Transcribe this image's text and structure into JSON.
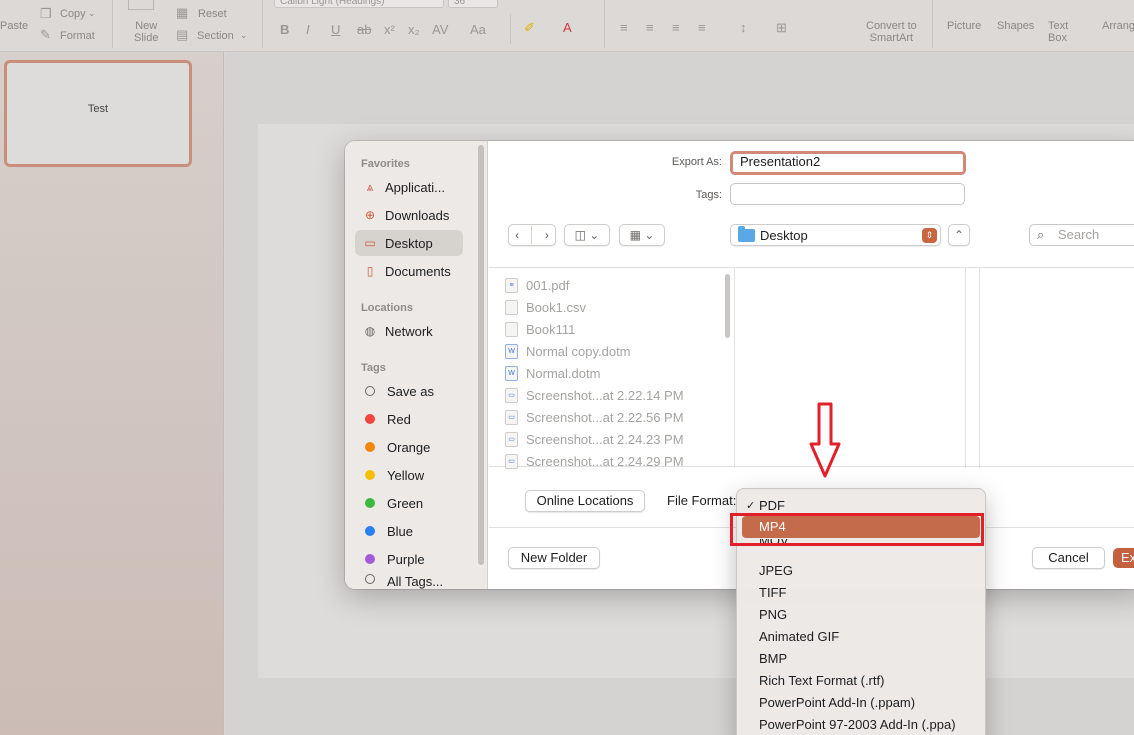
{
  "ribbon": {
    "paste": "Paste",
    "copy": "Copy",
    "format": "Format",
    "new_slide": "New\nSlide",
    "reset": "Reset",
    "section": "Section",
    "font_name": "Calibri Light (Headings)",
    "font_size": "36",
    "convert_smartart": "Convert to\nSmartArt",
    "picture": "Picture",
    "shapes": "Shapes",
    "text_box": "Text\nBox",
    "arrange": "Arrang"
  },
  "thumbnail": {
    "text": "Test"
  },
  "dialog": {
    "sidebar": {
      "favorites_head": "Favorites",
      "favorites": [
        {
          "label": "Applicati...",
          "icon": "applications-icon"
        },
        {
          "label": "Downloads",
          "icon": "downloads-icon"
        },
        {
          "label": "Desktop",
          "icon": "desktop-icon",
          "selected": true
        },
        {
          "label": "Documents",
          "icon": "documents-icon"
        }
      ],
      "locations_head": "Locations",
      "locations": [
        {
          "label": "Network",
          "icon": "network-icon"
        }
      ],
      "tags_head": "Tags",
      "tags": [
        {
          "label": "Save as",
          "color": ""
        },
        {
          "label": "Red",
          "color": "#f2453d"
        },
        {
          "label": "Orange",
          "color": "#f3860d"
        },
        {
          "label": "Yellow",
          "color": "#f5c000"
        },
        {
          "label": "Green",
          "color": "#3cb93c"
        },
        {
          "label": "Blue",
          "color": "#2a7ff0"
        },
        {
          "label": "Purple",
          "color": "#a45ad6"
        },
        {
          "label": "All Tags...",
          "color": ""
        }
      ]
    },
    "export_as_label": "Export As:",
    "export_as_value": "Presentation2",
    "tags_label": "Tags:",
    "location": "Desktop",
    "search_placeholder": "Search",
    "files": [
      {
        "name": "001.pdf",
        "type": "pdf"
      },
      {
        "name": "Book1.csv",
        "type": "csv"
      },
      {
        "name": "Book111",
        "type": "doc"
      },
      {
        "name": "Normal copy.dotm",
        "type": "word"
      },
      {
        "name": "Normal.dotm",
        "type": "word"
      },
      {
        "name": "Screenshot...at 2.22.14 PM",
        "type": "image"
      },
      {
        "name": "Screenshot...at 2.22.56 PM",
        "type": "image"
      },
      {
        "name": "Screenshot...at 2.24.23 PM",
        "type": "image"
      },
      {
        "name": "Screenshot...at 2.24.29 PM",
        "type": "image"
      }
    ],
    "online_locations": "Online Locations",
    "file_format_label": "File Format:",
    "new_folder": "New Folder",
    "cancel": "Cancel",
    "export_button": "Export"
  },
  "format_menu": {
    "checked": "PDF",
    "highlighted": "MP4",
    "items": [
      "PDF",
      "MP4",
      "MOV",
      "JPEG",
      "TIFF",
      "PNG",
      "Animated GIF",
      "BMP",
      "Rich Text Format (.rtf)",
      "PowerPoint Add-In (.ppam)",
      "PowerPoint 97-2003 Add-In (.ppa)"
    ]
  },
  "colors": {
    "accent": "#c4603d",
    "highlight": "#c36b4b",
    "annotation_red": "#e2202a"
  }
}
